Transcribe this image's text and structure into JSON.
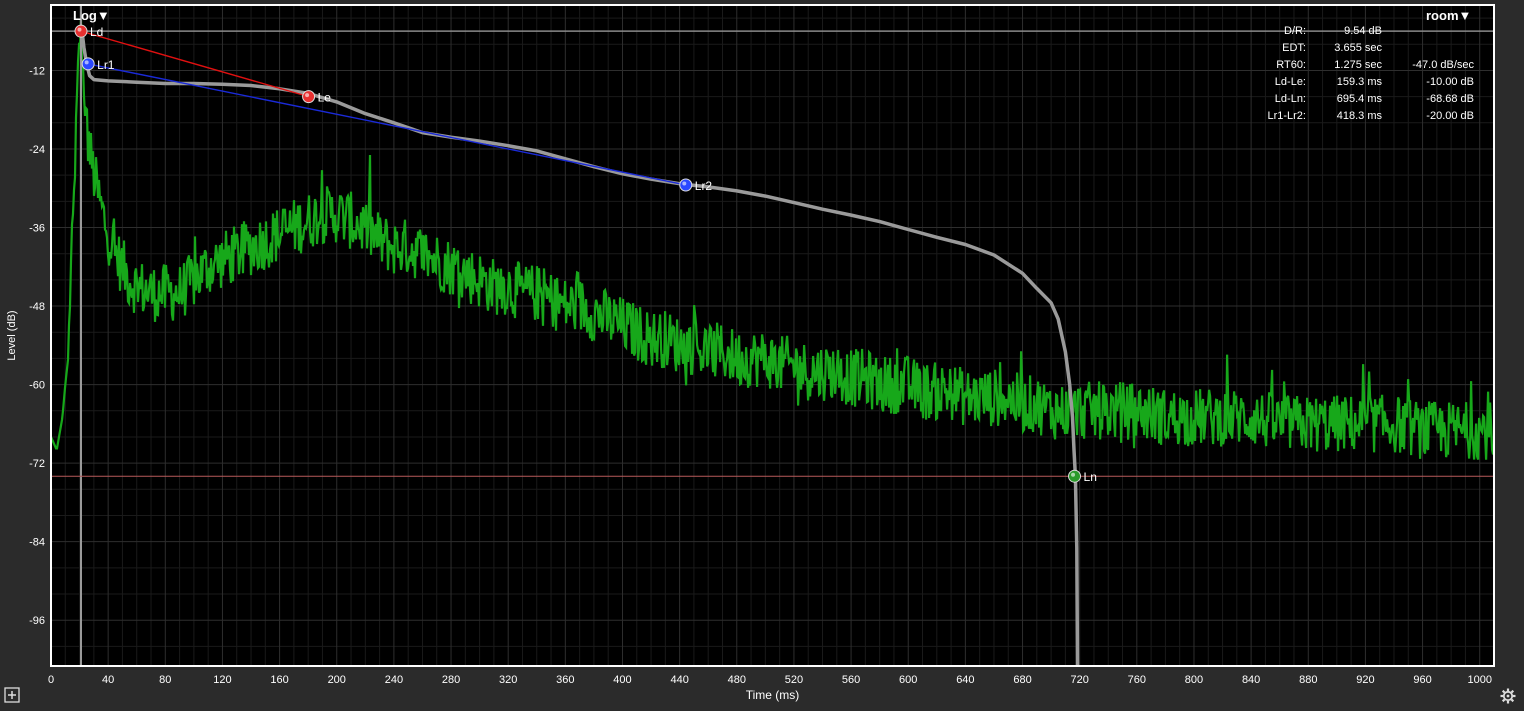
{
  "controls": {
    "scale_menu": "Log▼",
    "view_menu": "room▼"
  },
  "icons": {
    "add": "plus-square-icon",
    "settings": "gear-icon"
  },
  "stats": [
    {
      "label": "D/R:",
      "v1": "9.54 dB",
      "v2": ""
    },
    {
      "label": "EDT:",
      "v1": "3.655 sec",
      "v2": ""
    },
    {
      "label": "RT60:",
      "v1": "1.275 sec",
      "v2": "-47.0 dB/sec"
    },
    {
      "label": "Ld-Le:",
      "v1": "159.3 ms",
      "v2": "-10.00 dB"
    },
    {
      "label": "Ld-Ln:",
      "v1": "695.4 ms",
      "v2": "-68.68 dB"
    },
    {
      "label": "Lr1-Lr2:",
      "v1": "418.3 ms",
      "v2": "-20.00 dB"
    }
  ],
  "chart_data": {
    "type": "line",
    "xlabel": "Time (ms)",
    "ylabel": "Level (dB)",
    "xlim": [
      0,
      1010
    ],
    "ylim": [
      -103,
      -2
    ],
    "x_ticks": [
      0,
      40,
      80,
      120,
      160,
      200,
      240,
      280,
      320,
      360,
      400,
      440,
      480,
      520,
      560,
      600,
      640,
      680,
      720,
      760,
      800,
      840,
      880,
      920,
      960,
      1000
    ],
    "y_ticks": [
      -12,
      -24,
      -36,
      -48,
      -60,
      -72,
      -84,
      -96
    ],
    "colors": {
      "impulse": "#17a81a",
      "schroeder": "#9a9a9a",
      "red_fit": "#e01010",
      "blue_fit": "#1a2ad8",
      "noise_floor": "#b85a5a"
    },
    "cursor_x": 21,
    "noise_floor": -74,
    "reference_level": -6,
    "schroeder_curve": [
      [
        21,
        -6
      ],
      [
        22,
        -6.5
      ],
      [
        23,
        -8.5
      ],
      [
        25,
        -11
      ],
      [
        27,
        -12.8
      ],
      [
        30,
        -13.4
      ],
      [
        40,
        -13.6
      ],
      [
        60,
        -13.8
      ],
      [
        80,
        -14
      ],
      [
        100,
        -14
      ],
      [
        120,
        -14.1
      ],
      [
        140,
        -14.3
      ],
      [
        160,
        -14.8
      ],
      [
        180,
        -15.5
      ],
      [
        200,
        -16.8
      ],
      [
        220,
        -18.6
      ],
      [
        240,
        -20
      ],
      [
        260,
        -21.5
      ],
      [
        280,
        -22.2
      ],
      [
        300,
        -22.8
      ],
      [
        320,
        -23.5
      ],
      [
        340,
        -24.3
      ],
      [
        360,
        -25.5
      ],
      [
        380,
        -26.7
      ],
      [
        400,
        -27.8
      ],
      [
        420,
        -28.6
      ],
      [
        440,
        -29.3
      ],
      [
        460,
        -29.8
      ],
      [
        480,
        -30.4
      ],
      [
        500,
        -31.2
      ],
      [
        520,
        -32.2
      ],
      [
        540,
        -33.2
      ],
      [
        560,
        -34.1
      ],
      [
        580,
        -35.1
      ],
      [
        600,
        -36.3
      ],
      [
        620,
        -37.5
      ],
      [
        640,
        -38.6
      ],
      [
        660,
        -40.2
      ],
      [
        680,
        -43
      ],
      [
        690,
        -45.3
      ],
      [
        700,
        -47.5
      ],
      [
        705,
        -50
      ],
      [
        710,
        -55
      ],
      [
        713,
        -60
      ],
      [
        715,
        -65
      ],
      [
        716,
        -70
      ],
      [
        717,
        -74
      ],
      [
        718,
        -85
      ],
      [
        718.5,
        -103
      ]
    ],
    "impulse_envelope": [
      [
        0,
        -68
      ],
      [
        4,
        -70
      ],
      [
        8,
        -65
      ],
      [
        10,
        -60
      ],
      [
        12,
        -56
      ],
      [
        14,
        -42
      ],
      [
        16,
        -32
      ],
      [
        18,
        -18
      ],
      [
        19,
        -12
      ],
      [
        20,
        -8
      ],
      [
        21,
        -6
      ],
      [
        22,
        -10
      ],
      [
        23,
        -14
      ],
      [
        24,
        -18
      ],
      [
        25,
        -21
      ],
      [
        27,
        -24
      ],
      [
        30,
        -28
      ],
      [
        35,
        -33
      ],
      [
        40,
        -37
      ],
      [
        45,
        -40
      ],
      [
        50,
        -42
      ],
      [
        55,
        -44
      ],
      [
        60,
        -45
      ],
      [
        70,
        -46
      ],
      [
        80,
        -46
      ],
      [
        90,
        -46
      ],
      [
        100,
        -44
      ],
      [
        110,
        -42
      ],
      [
        120,
        -41
      ],
      [
        130,
        -40
      ],
      [
        140,
        -39
      ],
      [
        150,
        -38
      ],
      [
        160,
        -37
      ],
      [
        170,
        -36
      ],
      [
        180,
        -35
      ],
      [
        190,
        -34
      ],
      [
        200,
        -34
      ],
      [
        210,
        -35
      ],
      [
        220,
        -36
      ],
      [
        230,
        -38
      ],
      [
        240,
        -39
      ],
      [
        250,
        -39
      ],
      [
        260,
        -40
      ],
      [
        270,
        -41
      ],
      [
        280,
        -42
      ],
      [
        290,
        -43
      ],
      [
        300,
        -44
      ],
      [
        310,
        -45
      ],
      [
        320,
        -45
      ],
      [
        330,
        -46
      ],
      [
        340,
        -46
      ],
      [
        350,
        -47
      ],
      [
        360,
        -48
      ],
      [
        370,
        -48
      ],
      [
        380,
        -49
      ],
      [
        390,
        -50
      ],
      [
        400,
        -51
      ],
      [
        410,
        -52
      ],
      [
        420,
        -53
      ],
      [
        430,
        -53
      ],
      [
        440,
        -54
      ],
      [
        450,
        -54
      ],
      [
        460,
        -55
      ],
      [
        470,
        -55
      ],
      [
        480,
        -56
      ],
      [
        490,
        -56
      ],
      [
        500,
        -56
      ],
      [
        510,
        -57
      ],
      [
        520,
        -57
      ],
      [
        530,
        -58
      ],
      [
        540,
        -58
      ],
      [
        550,
        -58
      ],
      [
        560,
        -59
      ],
      [
        570,
        -59
      ],
      [
        580,
        -60
      ],
      [
        590,
        -60
      ],
      [
        600,
        -60
      ],
      [
        610,
        -61
      ],
      [
        620,
        -61
      ],
      [
        630,
        -61
      ],
      [
        640,
        -62
      ],
      [
        650,
        -62
      ],
      [
        660,
        -62
      ],
      [
        670,
        -62
      ],
      [
        680,
        -63
      ],
      [
        690,
        -63
      ],
      [
        700,
        -64
      ],
      [
        720,
        -64
      ],
      [
        740,
        -64
      ],
      [
        760,
        -64
      ],
      [
        780,
        -65
      ],
      [
        800,
        -65
      ],
      [
        820,
        -65
      ],
      [
        840,
        -65
      ],
      [
        860,
        -66
      ],
      [
        880,
        -66
      ],
      [
        900,
        -66
      ],
      [
        920,
        -66
      ],
      [
        940,
        -66
      ],
      [
        960,
        -67
      ],
      [
        980,
        -67
      ],
      [
        1000,
        -67
      ],
      [
        1010,
        -67
      ]
    ],
    "markers": [
      {
        "label": "Ld",
        "x": 21,
        "y": -6,
        "color": "#e83030"
      },
      {
        "label": "Lr1",
        "x": 26,
        "y": -11,
        "color": "#2a48ff"
      },
      {
        "label": "Le",
        "x": 180.3,
        "y": -16,
        "color": "#e83030"
      },
      {
        "label": "Lr2",
        "x": 444.3,
        "y": -29.5,
        "color": "#2a48ff"
      },
      {
        "label": "Ln",
        "x": 716.4,
        "y": -74,
        "color": "#2a9a2a"
      }
    ],
    "fit_lines": [
      {
        "from": "Ld",
        "to": "Le",
        "color": "#e01010"
      },
      {
        "from": "Lr1",
        "to": "Lr2",
        "color": "#1a2ad8"
      }
    ]
  }
}
